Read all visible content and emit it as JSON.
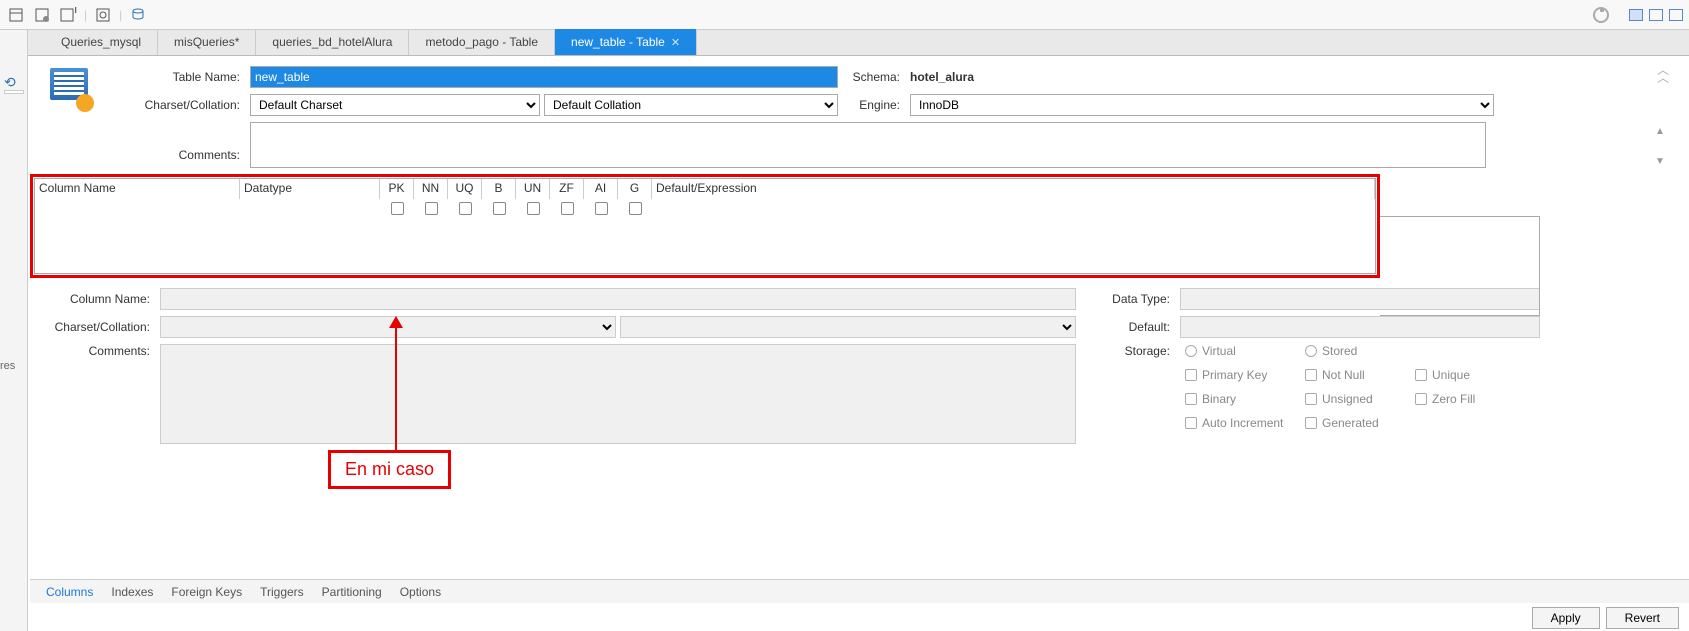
{
  "tabs": [
    {
      "label": "Queries_mysql"
    },
    {
      "label": "misQueries*"
    },
    {
      "label": "queries_bd_hotelAlura"
    },
    {
      "label": "metodo_pago - Table"
    },
    {
      "label": "new_table - Table",
      "active": true
    }
  ],
  "form": {
    "table_name_label": "Table Name:",
    "table_name_value": "new_table",
    "schema_label": "Schema:",
    "schema_value": "hotel_alura",
    "charset_label": "Charset/Collation:",
    "charset_value": "Default Charset",
    "collation_value": "Default Collation",
    "engine_label": "Engine:",
    "engine_value": "InnoDB",
    "comments_label": "Comments:",
    "comments_value": ""
  },
  "columns_grid": {
    "headers": {
      "name": "Column Name",
      "datatype": "Datatype",
      "pk": "PK",
      "nn": "NN",
      "uq": "UQ",
      "b": "B",
      "un": "UN",
      "zf": "ZF",
      "ai": "AI",
      "g": "G",
      "def": "Default/Expression"
    }
  },
  "annotation": {
    "text": "En mi caso"
  },
  "detail": {
    "col_name_label": "Column Name:",
    "charset_label": "Charset/Collation:",
    "comments_label": "Comments:",
    "datatype_label": "Data Type:",
    "default_label": "Default:",
    "storage_label": "Storage:",
    "opts": {
      "virtual": "Virtual",
      "stored": "Stored",
      "pk": "Primary Key",
      "nn": "Not Null",
      "uq": "Unique",
      "bin": "Binary",
      "un": "Unsigned",
      "zf": "Zero Fill",
      "ai": "Auto Increment",
      "gen": "Generated"
    }
  },
  "bottom_tabs": [
    {
      "label": "Columns",
      "active": true
    },
    {
      "label": "Indexes"
    },
    {
      "label": "Foreign Keys"
    },
    {
      "label": "Triggers"
    },
    {
      "label": "Partitioning"
    },
    {
      "label": "Options"
    }
  ],
  "footer": {
    "apply": "Apply",
    "revert": "Revert"
  },
  "left_panel_label": "res"
}
